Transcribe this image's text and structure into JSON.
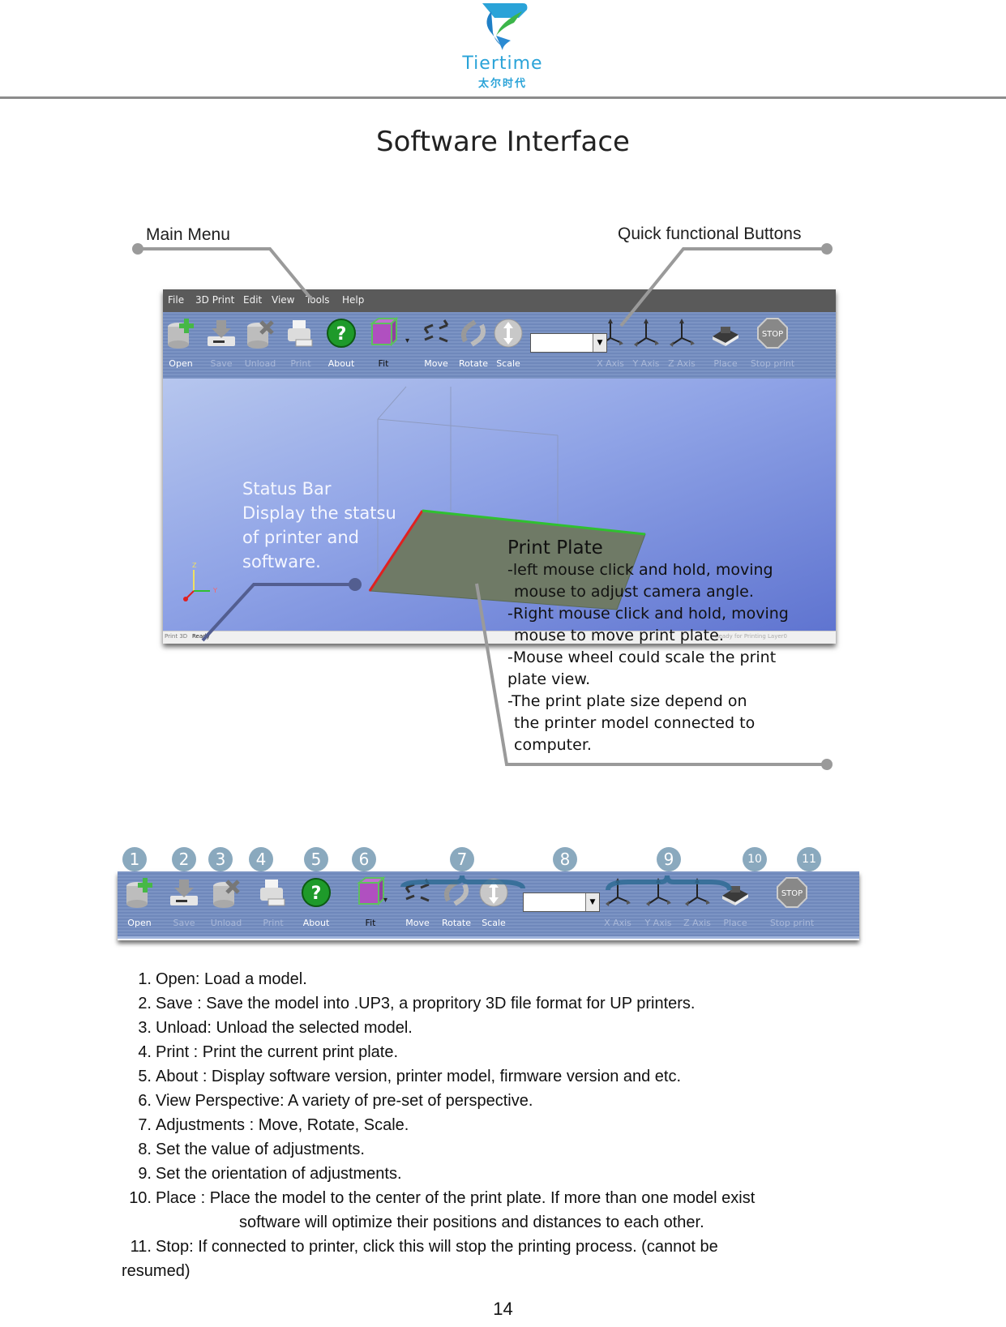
{
  "brand": {
    "name": "Tiertime",
    "name_cn": "太尔时代",
    "colors": {
      "blue": "#2aa3d8",
      "green": "#3cb54a"
    }
  },
  "page_title": "Software Interface",
  "callouts": {
    "main_menu": "Main Menu",
    "quick_buttons": "Quick functional Buttons",
    "status_bar": {
      "title": "Status Bar",
      "lines": [
        "Display the statsu",
        "of printer and",
        "software."
      ]
    },
    "print_plate": {
      "title": "Print Plate",
      "lines": [
        "-left mouse click and hold, moving",
        "mouse to adjust camera angle.",
        "-Right mouse click and hold, moving",
        "mouse to move print plate.",
        "-Mouse wheel could scale the print",
        "plate view.",
        "-The print plate size depend on",
        "the printer model connected to",
        "computer."
      ]
    }
  },
  "app": {
    "menu": [
      "File",
      "3D Print",
      "Edit",
      "View",
      "Tools",
      "Help"
    ],
    "toolbar": [
      {
        "label": "Open",
        "icon": "open-icon",
        "state": "enabled"
      },
      {
        "label": "Save",
        "icon": "save-icon",
        "state": "disabled"
      },
      {
        "label": "Unload",
        "icon": "unload-icon",
        "state": "disabled"
      },
      {
        "label": "Print",
        "icon": "print-icon",
        "state": "disabled"
      },
      {
        "label": "About",
        "icon": "about-icon",
        "state": "enabled"
      },
      {
        "label": "Fit",
        "icon": "fit-view-icon",
        "state": "enabled"
      },
      {
        "label": "Move",
        "icon": "move-icon",
        "state": "enabled"
      },
      {
        "label": "Rotate",
        "icon": "rotate-icon",
        "state": "enabled"
      },
      {
        "label": "Scale",
        "icon": "scale-icon",
        "state": "enabled"
      },
      {
        "label": "X Axis",
        "icon": "x-axis-icon",
        "state": "disabled"
      },
      {
        "label": "Y Axis",
        "icon": "y-axis-icon",
        "state": "disabled"
      },
      {
        "label": "Z Axis",
        "icon": "z-axis-icon",
        "state": "disabled"
      },
      {
        "label": "Place",
        "icon": "place-icon",
        "state": "disabled"
      },
      {
        "label": "Stop print",
        "icon": "stop-icon",
        "state": "disabled"
      }
    ],
    "value_box": "",
    "stop_sign_text": "STOP",
    "status_bar": {
      "left": "Print 3D",
      "state": "Ready",
      "right": "Ready for Printing Layer0"
    },
    "axis_labels": {
      "y": "Y",
      "z": "Z"
    }
  },
  "badges": [
    "1",
    "2",
    "3",
    "4",
    "5",
    "6",
    "7",
    "8",
    "9",
    "10",
    "11"
  ],
  "descriptions": [
    {
      "num": "1.",
      "text": "Open: Load a model."
    },
    {
      "num": "2.",
      "text": "Save : Save the model into .UP3, a propritory 3D file format for UP printers."
    },
    {
      "num": "3.",
      "text": "Unload: Unload the selected model."
    },
    {
      "num": "4.",
      "text": "Print : Print the current print plate."
    },
    {
      "num": "5.",
      "text": "About : Display software version, printer model, firmware version and etc."
    },
    {
      "num": "6.",
      "text": "View Perspective: A variety of pre-set of perspective."
    },
    {
      "num": "7.",
      "text": "Adjustments : Move, Rotate, Scale."
    },
    {
      "num": "8.",
      "text": "Set the value of adjustments."
    },
    {
      "num": "9.",
      "text": "Set the orientation of adjustments."
    },
    {
      "num": "10.",
      "text": "Place : Place the model to the center of the print plate. If more than one model exist"
    },
    {
      "num": "",
      "text": "software will optimize their positions and distances to each other."
    },
    {
      "num": "11.",
      "text": "Stop: If connected to printer, click this will stop the printing process. (cannot be"
    },
    {
      "num": "",
      "text": "resumed)"
    }
  ],
  "page_number": "14"
}
